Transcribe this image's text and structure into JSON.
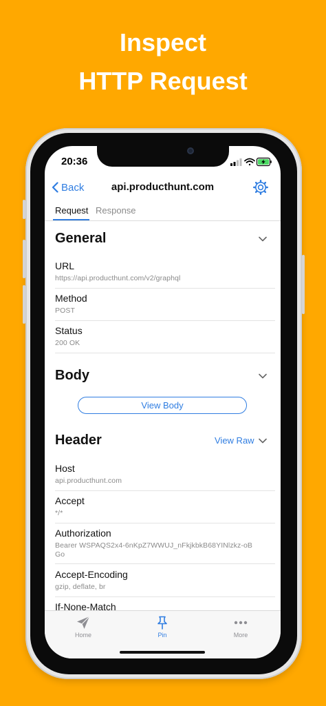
{
  "headline": {
    "line1": "Inspect",
    "line2": "HTTP Request"
  },
  "status_bar": {
    "time": "20:36"
  },
  "nav": {
    "back_label": "Back",
    "title": "api.producthunt.com"
  },
  "tabs": [
    {
      "label": "Request",
      "selected": true
    },
    {
      "label": "Response",
      "selected": false
    }
  ],
  "general": {
    "title": "General",
    "rows": [
      {
        "label": "URL",
        "value": "https://api.producthunt.com/v2/graphql"
      },
      {
        "label": "Method",
        "value": "POST"
      },
      {
        "label": "Status",
        "value": "200 OK"
      }
    ]
  },
  "body": {
    "title": "Body",
    "view_body_label": "View Body"
  },
  "header": {
    "title": "Header",
    "view_raw_label": "View Raw",
    "rows": [
      {
        "label": "Host",
        "value": "api.producthunt.com"
      },
      {
        "label": "Accept",
        "value": "*/*"
      },
      {
        "label": "Authorization",
        "value_line1": "Bearer WSPAQS2x4-6nKpZ7WWUJ_nFkjkbkB68YINlzkz-oB",
        "value_line2": "Go"
      },
      {
        "label": "Accept-Encoding",
        "value": "gzip, deflate, br"
      },
      {
        "label": "If-None-Match",
        "value": ""
      }
    ]
  },
  "tabbar": [
    {
      "label": "Home",
      "icon": "paper-plane-icon"
    },
    {
      "label": "Pin",
      "icon": "pin-icon"
    },
    {
      "label": "More",
      "icon": "more-dots-icon"
    }
  ],
  "colors": {
    "accent": "#2F7DE1",
    "background": "#FFA800",
    "battery": "#4CD964"
  }
}
